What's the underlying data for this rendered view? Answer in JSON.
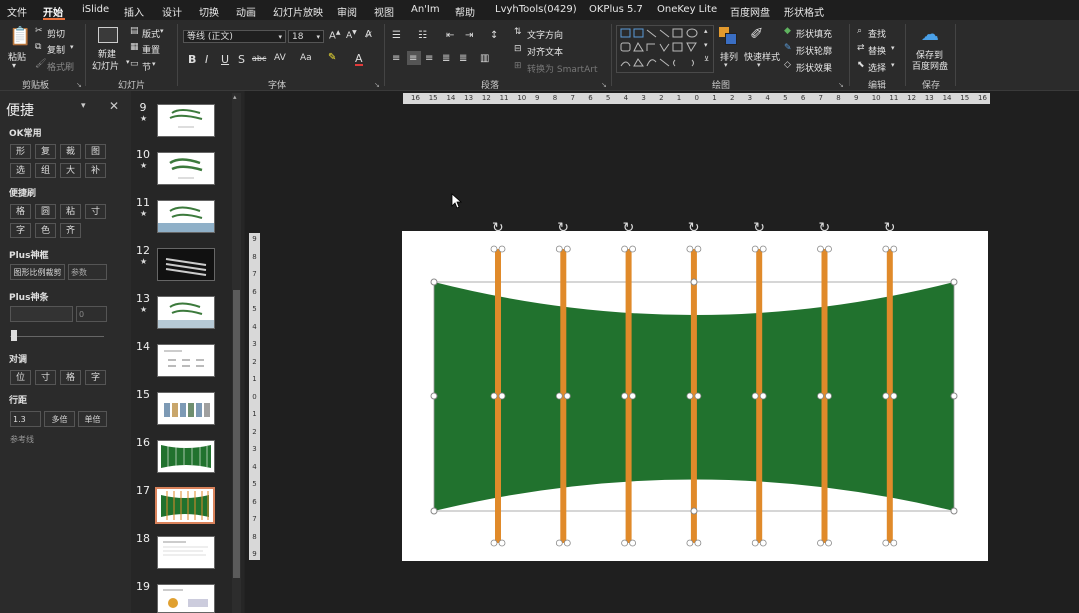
{
  "menubar": {
    "items": [
      "文件",
      "开始",
      "iSlide",
      "插入",
      "设计",
      "切换",
      "动画",
      "幻灯片放映",
      "审阅",
      "视图",
      "An'Im",
      "帮助",
      "LvyhTools(0429)",
      "OKPlus 5.7",
      "OneKey Lite",
      "百度网盘",
      "形状格式"
    ],
    "active": "开始"
  },
  "ribbon": {
    "clipboard": {
      "paste": "粘贴",
      "cut": "剪切",
      "copy": "复制",
      "format_painter": "格式刷",
      "group": "剪贴板"
    },
    "slides": {
      "new_slide": "新建",
      "new_slide2": "幻灯片",
      "layout": "版式",
      "reset": "重置",
      "section": "节",
      "group": "幻灯片"
    },
    "font": {
      "font_name": "等线 (正文)",
      "font_size": "18",
      "group": "字体",
      "bold": "B",
      "italic": "I",
      "underline": "U",
      "shadow": "S",
      "strike": "abc"
    },
    "paragraph": {
      "text_direction": "文字方向",
      "align_text": "对齐文本",
      "smartart": "转换为 SmartArt",
      "group": "段落"
    },
    "drawing": {
      "arrange": "排列",
      "quick_styles": "快速样式",
      "fill": "形状填充",
      "outline": "形状轮廓",
      "effects": "形状效果",
      "group": "绘图"
    },
    "editing": {
      "find": "查找",
      "replace": "替换",
      "select": "选择",
      "group": "编辑"
    },
    "save": {
      "line1": "保存到",
      "line2": "百度网盘",
      "group": "保存"
    }
  },
  "left_pane": {
    "title": "便捷",
    "ok_title": "OK常用",
    "ok_buttons": [
      "形",
      "复",
      "裁",
      "图",
      "选",
      "组",
      "大",
      "补"
    ],
    "quick_title": "便捷刷",
    "quick_buttons": [
      "格",
      "圆",
      "粘",
      "寸",
      "字",
      "色",
      "齐"
    ],
    "plus_frame_title": "Plus神框",
    "plus_frame_btn": "图形比例裁剪",
    "plus_frame_param": "参数",
    "plus_bar_title": "Plus神条",
    "plus_bar_value": "0",
    "align_title": "对调",
    "align_buttons": [
      "位",
      "寸",
      "格",
      "字"
    ],
    "spacing_title": "行距",
    "spacing_value": "1.3",
    "spacing_multi": "多倍",
    "spacing_single": "单倍",
    "ref_line": "参考线"
  },
  "thumbnails": [
    {
      "num": "9",
      "star": "★"
    },
    {
      "num": "10",
      "star": "★"
    },
    {
      "num": "11",
      "star": "★"
    },
    {
      "num": "12",
      "star": "★"
    },
    {
      "num": "13",
      "star": "★"
    },
    {
      "num": "14",
      "star": ""
    },
    {
      "num": "15",
      "star": ""
    },
    {
      "num": "16",
      "star": ""
    },
    {
      "num": "17",
      "star": ""
    },
    {
      "num": "18",
      "star": ""
    },
    {
      "num": "19",
      "star": ""
    }
  ],
  "selected_slide": "17",
  "hruler_ticks": [
    "16",
    "15",
    "14",
    "13",
    "12",
    "11",
    "10",
    "9",
    "8",
    "7",
    "6",
    "5",
    "4",
    "3",
    "2",
    "1",
    "0",
    "1",
    "2",
    "3",
    "4",
    "5",
    "6",
    "7",
    "8",
    "9",
    "10",
    "11",
    "12",
    "13",
    "14",
    "15",
    "16"
  ],
  "vruler_ticks": [
    "9",
    "8",
    "7",
    "6",
    "5",
    "4",
    "3",
    "2",
    "1",
    "0",
    "1",
    "2",
    "3",
    "4",
    "5",
    "6",
    "7",
    "8",
    "9"
  ],
  "colors": {
    "accent": "#e8703a",
    "shape_green": "#21722e",
    "orange_bar": "#e08a2a",
    "selected_border": "#d9825b"
  },
  "slide_canvas": {
    "bar_count": 7
  }
}
